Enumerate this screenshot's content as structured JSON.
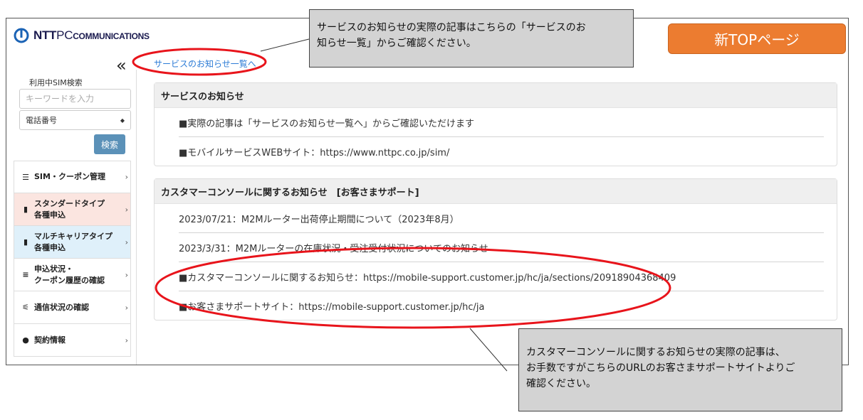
{
  "header": {
    "logo": {
      "ntt": "NTT",
      "pc": "PC",
      "comm": "COMMUNICATIONS"
    },
    "collapse_symbol": "«",
    "notice_list_link": "サービスのお知らせ一覧へ"
  },
  "sidebar": {
    "search_label": "利用中SIM検索",
    "search_placeholder": "キーワードを入力",
    "select_value": "電話番号",
    "search_button": "検索",
    "menu": [
      {
        "icon": "list-icon",
        "label": "SIM・クーポン管理"
      },
      {
        "icon": "sim-card-icon",
        "label_line1": "スタンダードタイプ",
        "label_line2": "各種申込"
      },
      {
        "icon": "sim-card-icon",
        "label_line1": "マルチキャリアタイプ",
        "label_line2": "各種申込"
      },
      {
        "icon": "search-list-icon",
        "label_line1": "申込状況・",
        "label_line2": "クーポン履歴の確認"
      },
      {
        "icon": "signal-icon",
        "label": "通信状況の確認"
      },
      {
        "icon": "info-icon",
        "label": "契約情報"
      }
    ]
  },
  "service_notice": {
    "title": "サービスのお知らせ",
    "items": [
      "■実際の記事は「サービスのお知らせ一覧へ」からご確認いただけます",
      "■モバイルサービスWEBサイト：https://www.nttpc.co.jp/sim/"
    ]
  },
  "console_notice": {
    "title": "カスタマーコンソールに関するお知らせ　[お客さまサポート]",
    "items": [
      "2023/07/21：M2Mルーター出荷停止期間について（2023年8月）",
      "2023/3/31：M2Mルーターの在庫状況・受注受付状況についてのお知らせ",
      "■カスタマーコンソールに関するお知らせ：https://mobile-support.customer.jp/hc/ja/sections/20918904368409",
      "■お客さまサポートサイト：https://mobile-support.customer.jp/hc/ja"
    ]
  },
  "callouts": {
    "top_line1": "サービスのお知らせの実際の記事はこちらの「サービスのお",
    "top_line2": "知らせ一覧」からご確認ください。",
    "bottom_line1": "カスタマーコンソールに関するお知らせの実際の記事は、",
    "bottom_line2": "お手数ですがこちらのURLのお客さまサポートサイトよりご",
    "bottom_line3": "確認ください。",
    "new_top": "新TOPページ"
  },
  "colors": {
    "annotation_red": "#e8141b",
    "new_top_orange": "#ec7c30",
    "link_blue": "#2b7bd6",
    "search_button": "#5b91b8"
  }
}
